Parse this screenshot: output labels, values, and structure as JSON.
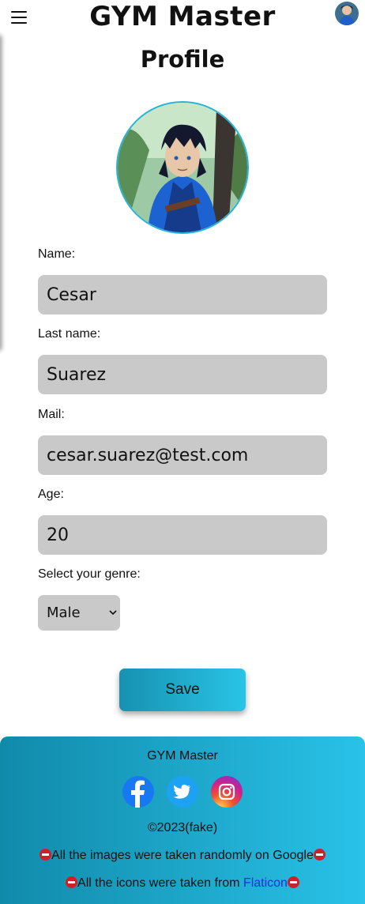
{
  "header": {
    "brand": "GYM Master",
    "menu_icon": "hamburger-icon",
    "avatar_icon": "user-avatar"
  },
  "page": {
    "title": "Profile"
  },
  "form": {
    "name_label": "Name:",
    "name_value": "Cesar",
    "lastname_label": "Last name:",
    "lastname_value": "Suarez",
    "mail_label": "Mail:",
    "mail_value": "cesar.suarez@test.com",
    "age_label": "Age:",
    "age_value": "20",
    "genre_label": "Select your genre:",
    "genre_value": "Male",
    "save_label": "Save"
  },
  "footer": {
    "title": "GYM Master",
    "social": [
      "facebook-icon",
      "twitter-icon",
      "instagram-icon"
    ],
    "copyright": "©2023(fake)",
    "images_note": "All the images were taken randomly on Google",
    "icons_note_prefix": "All the icons were taken from ",
    "icons_link": "Flaticon"
  },
  "colors": {
    "accent_start": "#118aaa",
    "accent_end": "#29c2e8",
    "input_bg": "#c9c9c9",
    "link": "#1b2fdc"
  }
}
